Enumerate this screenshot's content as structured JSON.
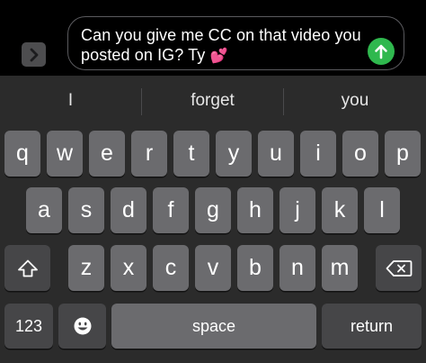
{
  "composer": {
    "message_line1": "Can you give me CC on that video you",
    "message_line2": "posted on IG? Ty",
    "emoji": "💕",
    "expand_icon": "chevron-right-icon",
    "send_icon": "arrow-up-icon",
    "send_color": "#2fb84e"
  },
  "suggestions": [
    "I",
    "forget",
    "you"
  ],
  "keyboard": {
    "row1": [
      "q",
      "w",
      "e",
      "r",
      "t",
      "y",
      "u",
      "i",
      "o",
      "p"
    ],
    "row2": [
      "a",
      "s",
      "d",
      "f",
      "g",
      "h",
      "j",
      "k",
      "l"
    ],
    "row3": [
      "z",
      "x",
      "c",
      "v",
      "b",
      "n",
      "m"
    ],
    "shift_icon": "shift-arrow-icon",
    "delete_icon": "backspace-icon",
    "numbers_label": "123",
    "emoji_icon": "emoji-face-icon",
    "space_label": "space",
    "return_label": "return"
  }
}
